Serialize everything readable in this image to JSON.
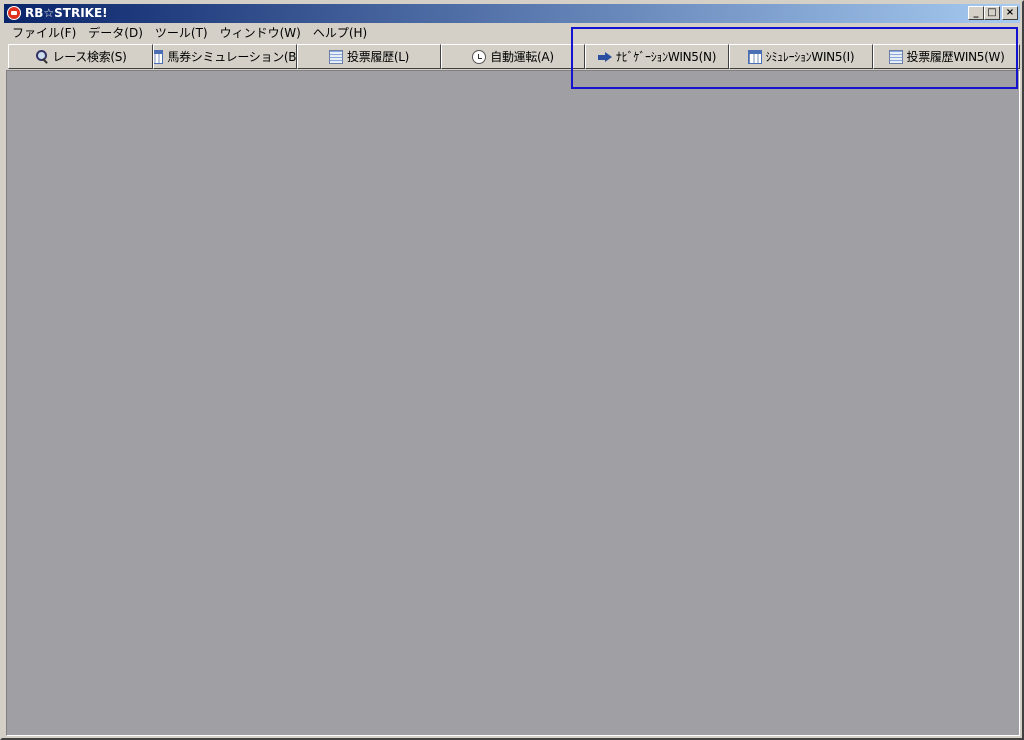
{
  "window": {
    "title": "RB☆STRIKE!"
  },
  "caption": {
    "minimize": "_",
    "maximize": "□",
    "close": "×"
  },
  "menu": [
    "ファイル(F)",
    "データ(D)",
    "ツール(T)",
    "ウィンドウ(W)",
    "ヘルプ(H)"
  ],
  "toolbar": [
    {
      "label": "レース検索(S)",
      "icon": "search-icon"
    },
    {
      "label": "馬券シミュレーション(B)",
      "icon": "grid-icon"
    },
    {
      "label": "投票履歴(L)",
      "icon": "document-icon"
    },
    {
      "label": "自動運転(A)",
      "icon": "clock-icon"
    },
    {
      "label": "ﾅﾋﾞｹﾞｰｼｮﾝWIN5(N)",
      "icon": "arrow-icon"
    },
    {
      "label": "ｼﾐｭﾚｰｼｮﾝWIN5(I)",
      "icon": "grid-icon"
    },
    {
      "label": "投票履歴WIN5(W)",
      "icon": "document-icon"
    }
  ],
  "colors": {
    "workspace": "#a09fa3",
    "highlight": "#1414d0",
    "titlebar_start": "#0a246a"
  }
}
